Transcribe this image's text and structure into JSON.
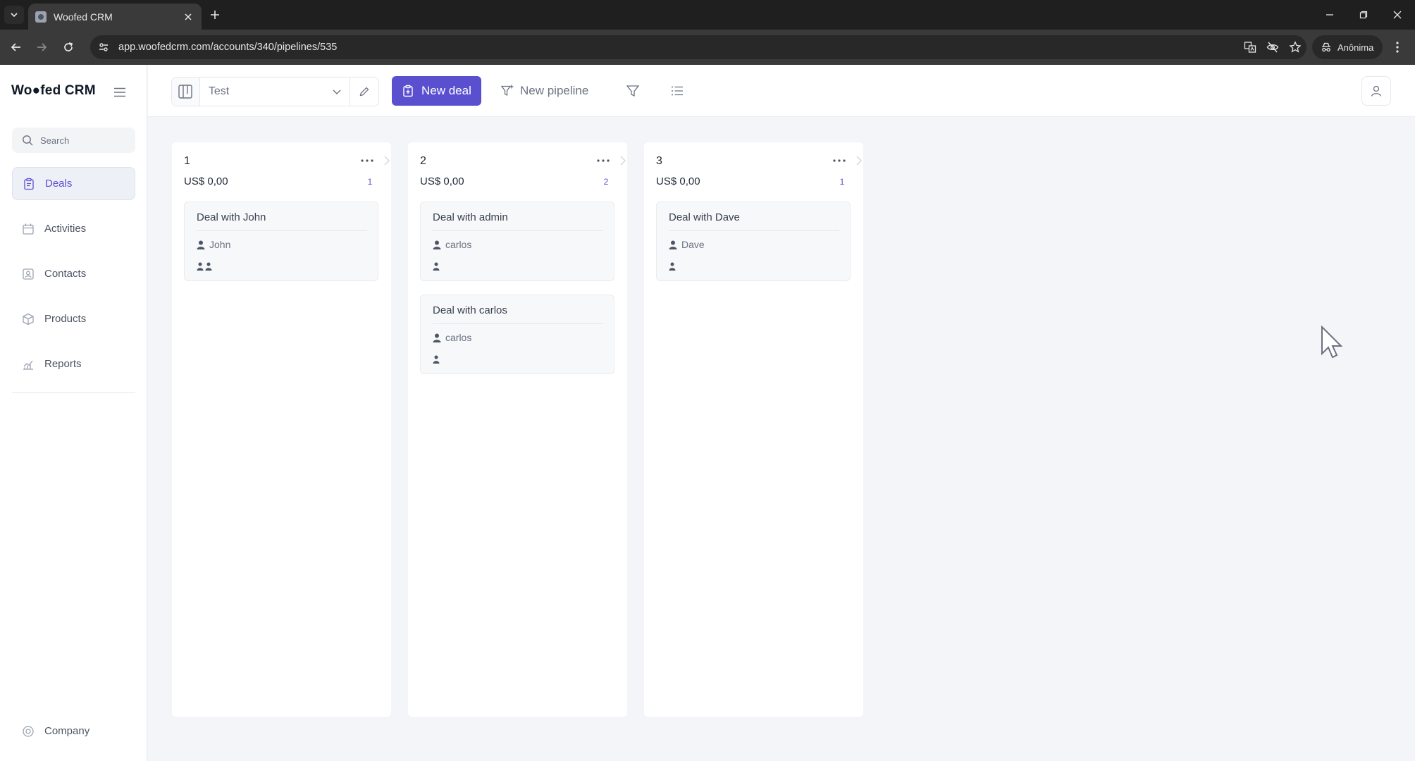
{
  "browser": {
    "tab_title": "Woofed CRM",
    "url": "app.woofedcrm.com/accounts/340/pipelines/535",
    "profile_label": "Anônima"
  },
  "app": {
    "logo": "Wo●fed CRM",
    "search_placeholder": "Search",
    "nav": [
      {
        "label": "Deals",
        "icon": "clipboard-icon",
        "active": true
      },
      {
        "label": "Activities",
        "icon": "calendar-icon",
        "active": false
      },
      {
        "label": "Contacts",
        "icon": "contact-card-icon",
        "active": false
      },
      {
        "label": "Products",
        "icon": "box-icon",
        "active": false
      },
      {
        "label": "Reports",
        "icon": "chart-icon",
        "active": false
      }
    ],
    "footer_nav": {
      "label": "Company",
      "icon": "settings-icon"
    }
  },
  "toolbar": {
    "pipeline_selected": "Test",
    "new_deal_label": "New deal",
    "new_pipeline_label": "New pipeline"
  },
  "columns": [
    {
      "name": "1",
      "amount": "US$ 0,00",
      "count": "1",
      "cards": [
        {
          "title": "Deal with John",
          "contact": "John",
          "users": 2
        }
      ]
    },
    {
      "name": "2",
      "amount": "US$ 0,00",
      "count": "2",
      "cards": [
        {
          "title": "Deal with admin",
          "contact": "carlos",
          "users": 1
        },
        {
          "title": "Deal with carlos",
          "contact": "carlos",
          "users": 1
        }
      ]
    },
    {
      "name": "3",
      "amount": "US$ 0,00",
      "count": "1",
      "cards": [
        {
          "title": "Deal with Dave",
          "contact": "Dave",
          "users": 1
        }
      ]
    }
  ],
  "colors": {
    "accent": "#5a4fcf",
    "background": "#f3f5f9",
    "card": "#f7f8fa"
  }
}
